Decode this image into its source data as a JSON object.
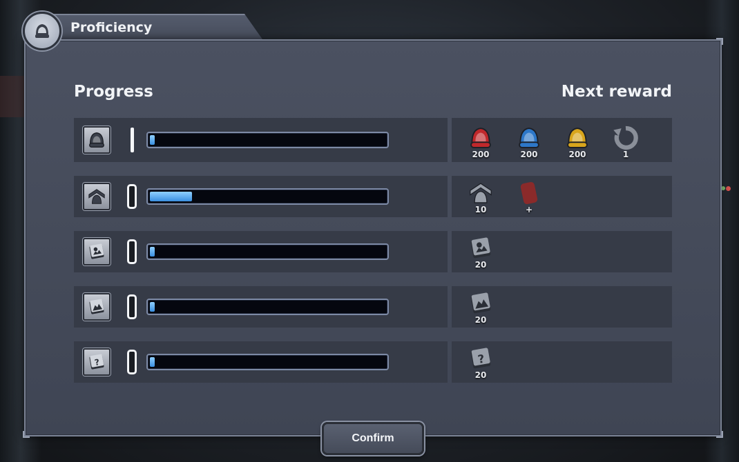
{
  "window": {
    "title": "Proficiency"
  },
  "headings": {
    "progress": "Progress",
    "next_reward": "Next reward"
  },
  "rows": [
    {
      "icon": "helmet-icon",
      "progress": 0.02,
      "rewards": [
        {
          "icon": "red-helmet-icon",
          "qty": "200",
          "color": "#c0282b"
        },
        {
          "icon": "blue-helmet-icon",
          "qty": "200",
          "color": "#2d77c8"
        },
        {
          "icon": "yellow-helmet-icon",
          "qty": "200",
          "color": "#d8a51c"
        },
        {
          "icon": "reset-arrow-icon",
          "qty": "1",
          "color": "#8a8f99"
        }
      ]
    },
    {
      "icon": "rank-chevron-icon",
      "progress": 0.18,
      "rewards": [
        {
          "icon": "rank-chevron-icon",
          "qty": "10",
          "color": "#9aa0aa"
        },
        {
          "icon": "red-card-icon",
          "qty": "+",
          "color": "#8a2a2a"
        }
      ]
    },
    {
      "icon": "book-sun-icon",
      "progress": 0.02,
      "rewards": [
        {
          "icon": "book-sun-icon",
          "qty": "20",
          "color": "#9aa0aa"
        }
      ]
    },
    {
      "icon": "book-mountain-icon",
      "progress": 0.02,
      "rewards": [
        {
          "icon": "book-mountain-icon",
          "qty": "20",
          "color": "#9aa0aa"
        }
      ]
    },
    {
      "icon": "book-question-icon",
      "progress": 0.02,
      "rewards": [
        {
          "icon": "book-question-icon",
          "qty": "20",
          "color": "#9aa0aa"
        }
      ]
    }
  ],
  "footer": {
    "confirm_label": "Confirm"
  }
}
